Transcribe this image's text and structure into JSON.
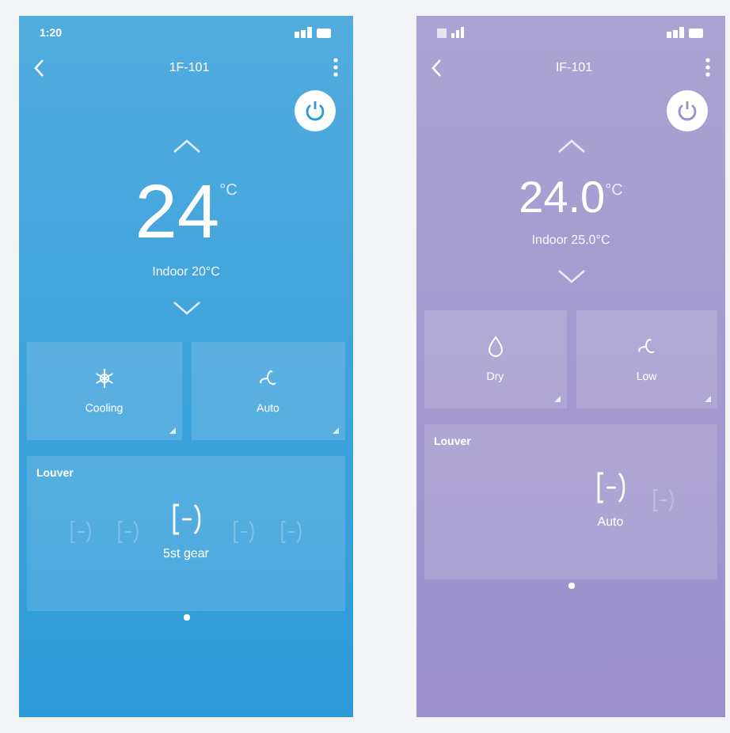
{
  "phones": [
    {
      "color": "#2a9ad8",
      "status_bar": {
        "time": "1:20"
      },
      "title": "1F-101",
      "temperature": "24",
      "unit": "°C",
      "indoor": "Indoor 20°C",
      "modes": [
        {
          "kind": "snowflake",
          "label": "Cooling"
        },
        {
          "kind": "fan",
          "label": "Auto"
        }
      ],
      "louver": {
        "title": "Louver",
        "items": [
          {
            "selected": false
          },
          {
            "selected": false
          },
          {
            "label": "5st gear",
            "selected": true
          },
          {
            "selected": false
          },
          {
            "selected": false
          }
        ]
      }
    },
    {
      "color": "#9a8fcb",
      "title": "IF-101",
      "temperature": "24.0",
      "unit": "°C",
      "indoor": "Indoor 25.0°C",
      "modes": [
        {
          "kind": "drop",
          "label": "Dry"
        },
        {
          "kind": "fan",
          "label": "Low"
        }
      ],
      "louver": {
        "title": "Louver",
        "items": [
          {
            "label": "Auto",
            "selected": true
          },
          {
            "selected": false
          }
        ]
      }
    }
  ]
}
